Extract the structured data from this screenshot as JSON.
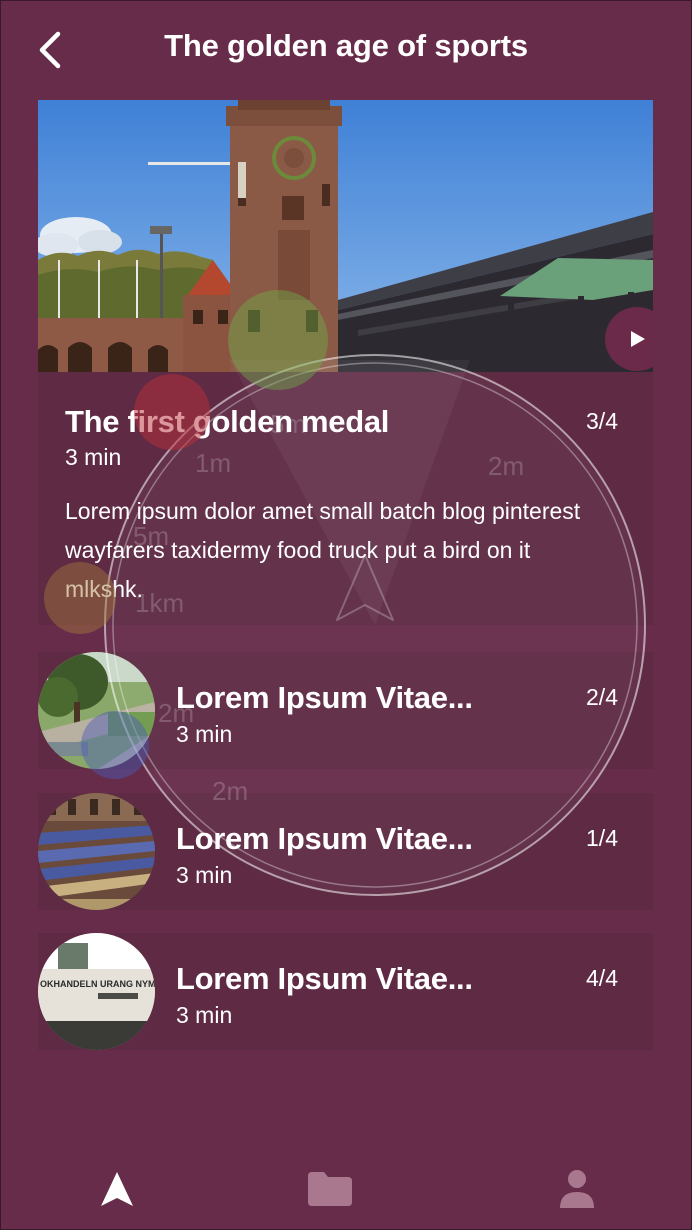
{
  "header": {
    "title": "The golden age of sports"
  },
  "featured": {
    "title": "The first golden medal",
    "duration": "3 min",
    "count": "3/4",
    "description": "Lorem ipsum dolor amet small batch blog pinterest wayfarers taxidermy food truck put a bird on it mlkshk."
  },
  "list": [
    {
      "title": "Lorem Ipsum Vitae...",
      "duration": "3 min",
      "count": "2/4"
    },
    {
      "title": "Lorem Ipsum Vitae...",
      "duration": "3 min",
      "count": "1/4"
    },
    {
      "title": "Lorem Ipsum Vitae...",
      "duration": "3 min",
      "count": "4/4",
      "sign_text": "OKHANDELN URANG NYMBLE PEDITIONEN"
    }
  ],
  "radar": {
    "labels": [
      "5m",
      "1m",
      "2m",
      "5m",
      "1km",
      "2m",
      "2m"
    ]
  },
  "bottom_nav": {
    "tabs": [
      {
        "icon": "navigation-arrow-icon",
        "active": true
      },
      {
        "icon": "folder-icon",
        "active": false
      },
      {
        "icon": "user-icon",
        "active": false
      }
    ]
  },
  "colors": {
    "background": "#662c49",
    "card": "#5e2a44",
    "text": "#ffffff",
    "inactive_icon": "#a9788f"
  }
}
